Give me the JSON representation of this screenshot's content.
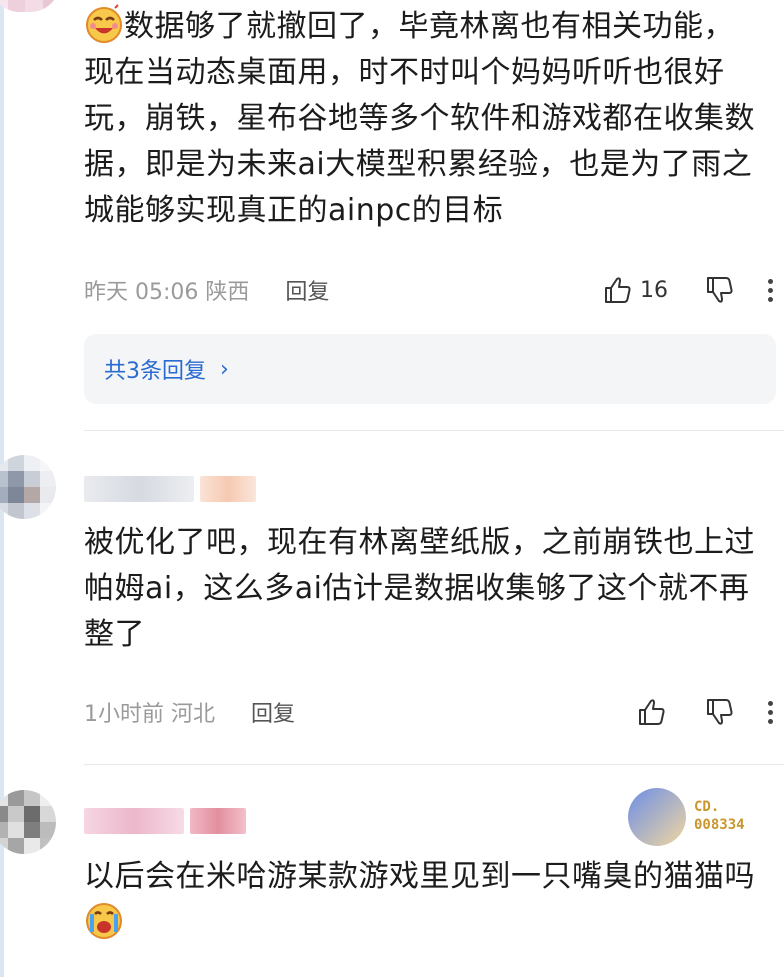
{
  "comments": [
    {
      "text_line1": "数据够了就撤回了，毕竟林离也有相关功能，",
      "text_rest": "现在当动态桌面用，时不时叫个妈妈听听也很好玩，崩铁，星布谷地等多个软件和游戏都在收集数据，即是为未来ai大模型积累经验，也是为了雨之城能够实现真正的ainpc的目标",
      "time": "昨天 05:06 陕西",
      "reply_label": "回复",
      "like_count": "16",
      "replies_summary": "共3条回复"
    },
    {
      "text": "被优化了吧，现在有林离壁纸版，之前崩铁也上过帕姆ai，这么多ai估计是数据收集够了这个就不再整了",
      "time": "1小时前 河北",
      "reply_label": "回复"
    },
    {
      "text": "以后会在米哈游某款游戏里见到一只嘴臭的猫猫吗",
      "badge_text_line1": "CD.",
      "badge_text_line2": "008334"
    }
  ],
  "icons": {
    "like": "thumbs-up-icon",
    "dislike": "thumbs-down-icon",
    "more": "more-vertical-icon",
    "chevron": "chevron-right-icon",
    "emoji_laugh": "laughing-emoji-icon",
    "emoji_cry": "crying-emoji-icon"
  },
  "colors": {
    "link": "#2a6bd1",
    "meta": "#9a9a9a",
    "badge": "#c9962f"
  }
}
